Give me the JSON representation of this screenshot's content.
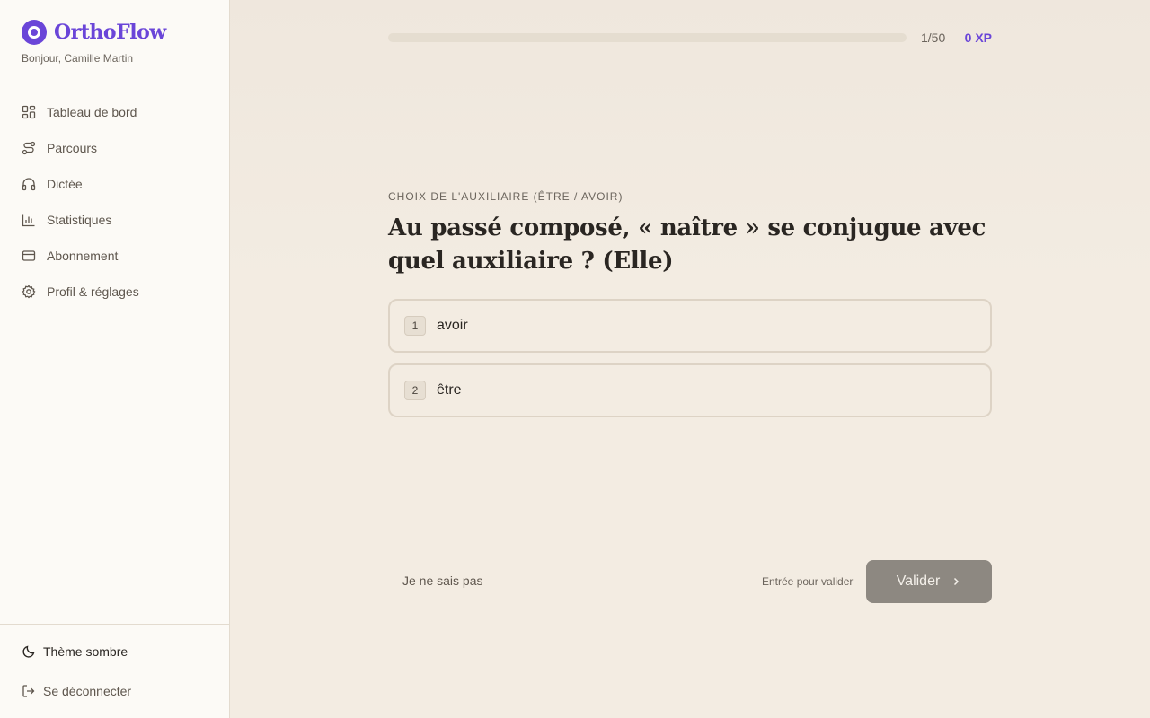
{
  "brand": {
    "name": "OrthoFlow",
    "accent": "#6a45d8"
  },
  "user": {
    "greeting": "Bonjour, Camille Martin"
  },
  "nav": [
    {
      "label": "Tableau de bord",
      "icon": "dashboard-icon"
    },
    {
      "label": "Parcours",
      "icon": "route-icon"
    },
    {
      "label": "Dictée",
      "icon": "headphones-icon"
    },
    {
      "label": "Statistiques",
      "icon": "bar-chart-icon"
    },
    {
      "label": "Abonnement",
      "icon": "credit-card-icon"
    },
    {
      "label": "Profil & réglages",
      "icon": "gear-icon"
    }
  ],
  "footer": {
    "theme_label": "Thème sombre",
    "logout_label": "Se déconnecter"
  },
  "progress": {
    "current": 1,
    "total": 50,
    "fraction": 0,
    "count_text": "1/50",
    "xp_text": "0 XP"
  },
  "exercise": {
    "category": "CHOIX DE L'AUXILIAIRE (ÊTRE / AVOIR)",
    "question": "Au passé composé, « naître » se conjugue avec quel auxiliaire ? (Elle)",
    "options": [
      {
        "key": "1",
        "label": "avoir"
      },
      {
        "key": "2",
        "label": "être"
      }
    ]
  },
  "actions": {
    "skip_label": "Je ne sais pas",
    "hint": "Entrée pour valider",
    "validate_label": "Valider"
  }
}
